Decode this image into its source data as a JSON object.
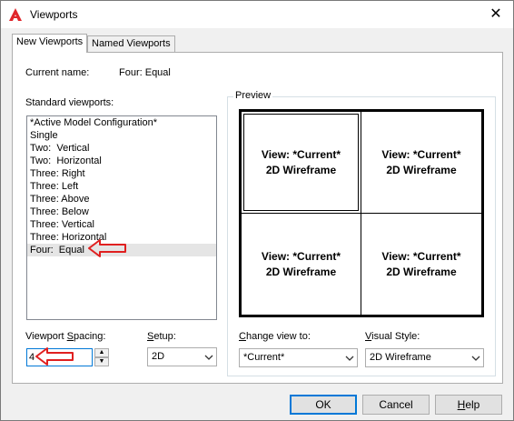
{
  "window": {
    "title": "Viewports",
    "close_glyph": "✕",
    "accent": "#0078d7"
  },
  "tabs": [
    {
      "label": "New Viewports",
      "active": true
    },
    {
      "label": "Named Viewports",
      "active": false
    }
  ],
  "current_name": {
    "label": "Current name:",
    "value": "Four: Equal"
  },
  "standard_viewports": {
    "label": "Standard viewports:",
    "items": [
      "*Active Model Configuration*",
      "Single",
      "Two:  Vertical",
      "Two:  Horizontal",
      "Three: Right",
      "Three: Left",
      "Three: Above",
      "Three: Below",
      "Three: Vertical",
      "Three: Horizontal",
      "Four:  Equal"
    ],
    "selected": "Four:  Equal"
  },
  "preview": {
    "caption": "Preview",
    "viewports": [
      {
        "line1": "View: *Current*",
        "line2": "2D Wireframe"
      },
      {
        "line1": "View: *Current*",
        "line2": "2D Wireframe"
      },
      {
        "line1": "View: *Current*",
        "line2": "2D Wireframe"
      },
      {
        "line1": "View: *Current*",
        "line2": "2D Wireframe"
      }
    ]
  },
  "viewport_spacing": {
    "label_pre": "Viewport ",
    "label_u": "S",
    "label_post": "pacing:",
    "value": "4"
  },
  "setup": {
    "label_pre": "",
    "label_u": "S",
    "label_post": "etup:",
    "value": "2D"
  },
  "change_view": {
    "label_pre": "",
    "label_u": "C",
    "label_post": "hange view to:",
    "value": "*Current*"
  },
  "visual_style": {
    "label_pre": "",
    "label_u": "V",
    "label_post": "isual Style:",
    "value": "2D Wireframe"
  },
  "buttons": {
    "ok": "OK",
    "cancel": "Cancel",
    "help_u": "H",
    "help_rest": "elp"
  },
  "annotation_color": "#e02020"
}
